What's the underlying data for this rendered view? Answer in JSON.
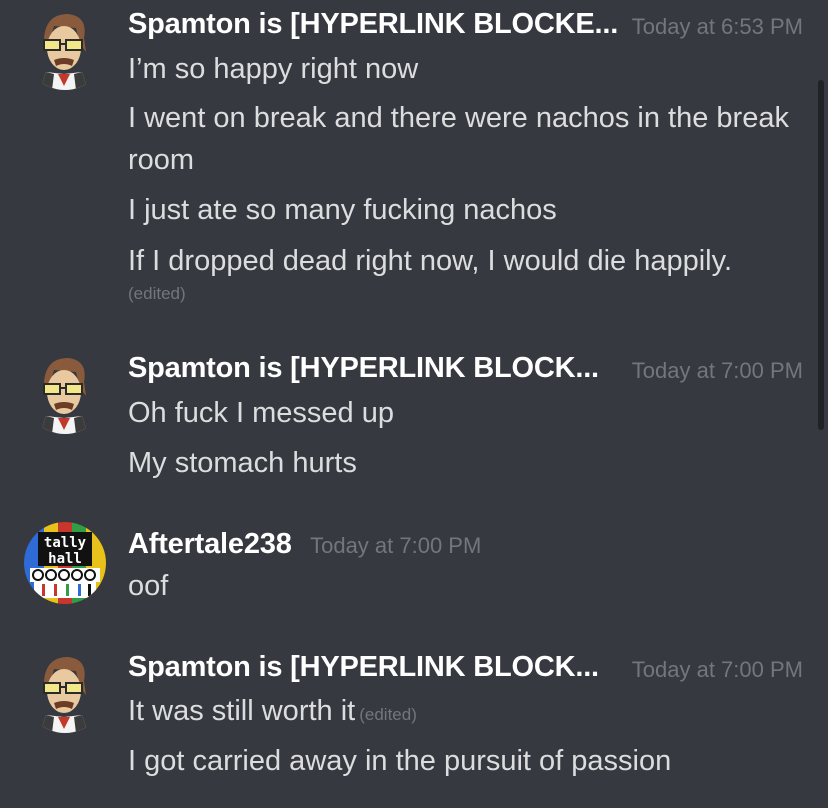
{
  "messages": [
    {
      "author": "Spamton is [HYPERLINK BLOCKE...",
      "time": "Today at 6:53 PM",
      "lines": [
        "I’m so happy right now",
        "I went on break and there were nachos in the break room",
        "I just ate so many fucking nachos",
        "If I dropped dead right now, I would die happily."
      ],
      "edited_label": "(edited)"
    },
    {
      "author": "Spamton is [HYPERLINK BLOCK...",
      "time": "Today at 7:00 PM",
      "lines": [
        "Oh fuck I messed up",
        "My stomach hurts"
      ]
    },
    {
      "author": "Aftertale238",
      "time": "Today at 7:00 PM",
      "lines": [
        "oof"
      ]
    },
    {
      "author": "Spamton is [HYPERLINK BLOCK...",
      "time": "Today at 7:00 PM",
      "lines": [
        "It was still worth it",
        "I got carried away in the pursuit of passion"
      ],
      "edited_label": "(edited)"
    }
  ],
  "icons": {
    "spamton_avatar": "spamton-avatar-icon",
    "tallyhall_avatar": "tally-hall-avatar-icon"
  },
  "avatar_text": {
    "line1": "tally",
    "line2": "hall"
  },
  "colors": {
    "background": "#36393f",
    "username": "#ffffff",
    "timestamp": "#72767d",
    "text": "#dcddde"
  }
}
